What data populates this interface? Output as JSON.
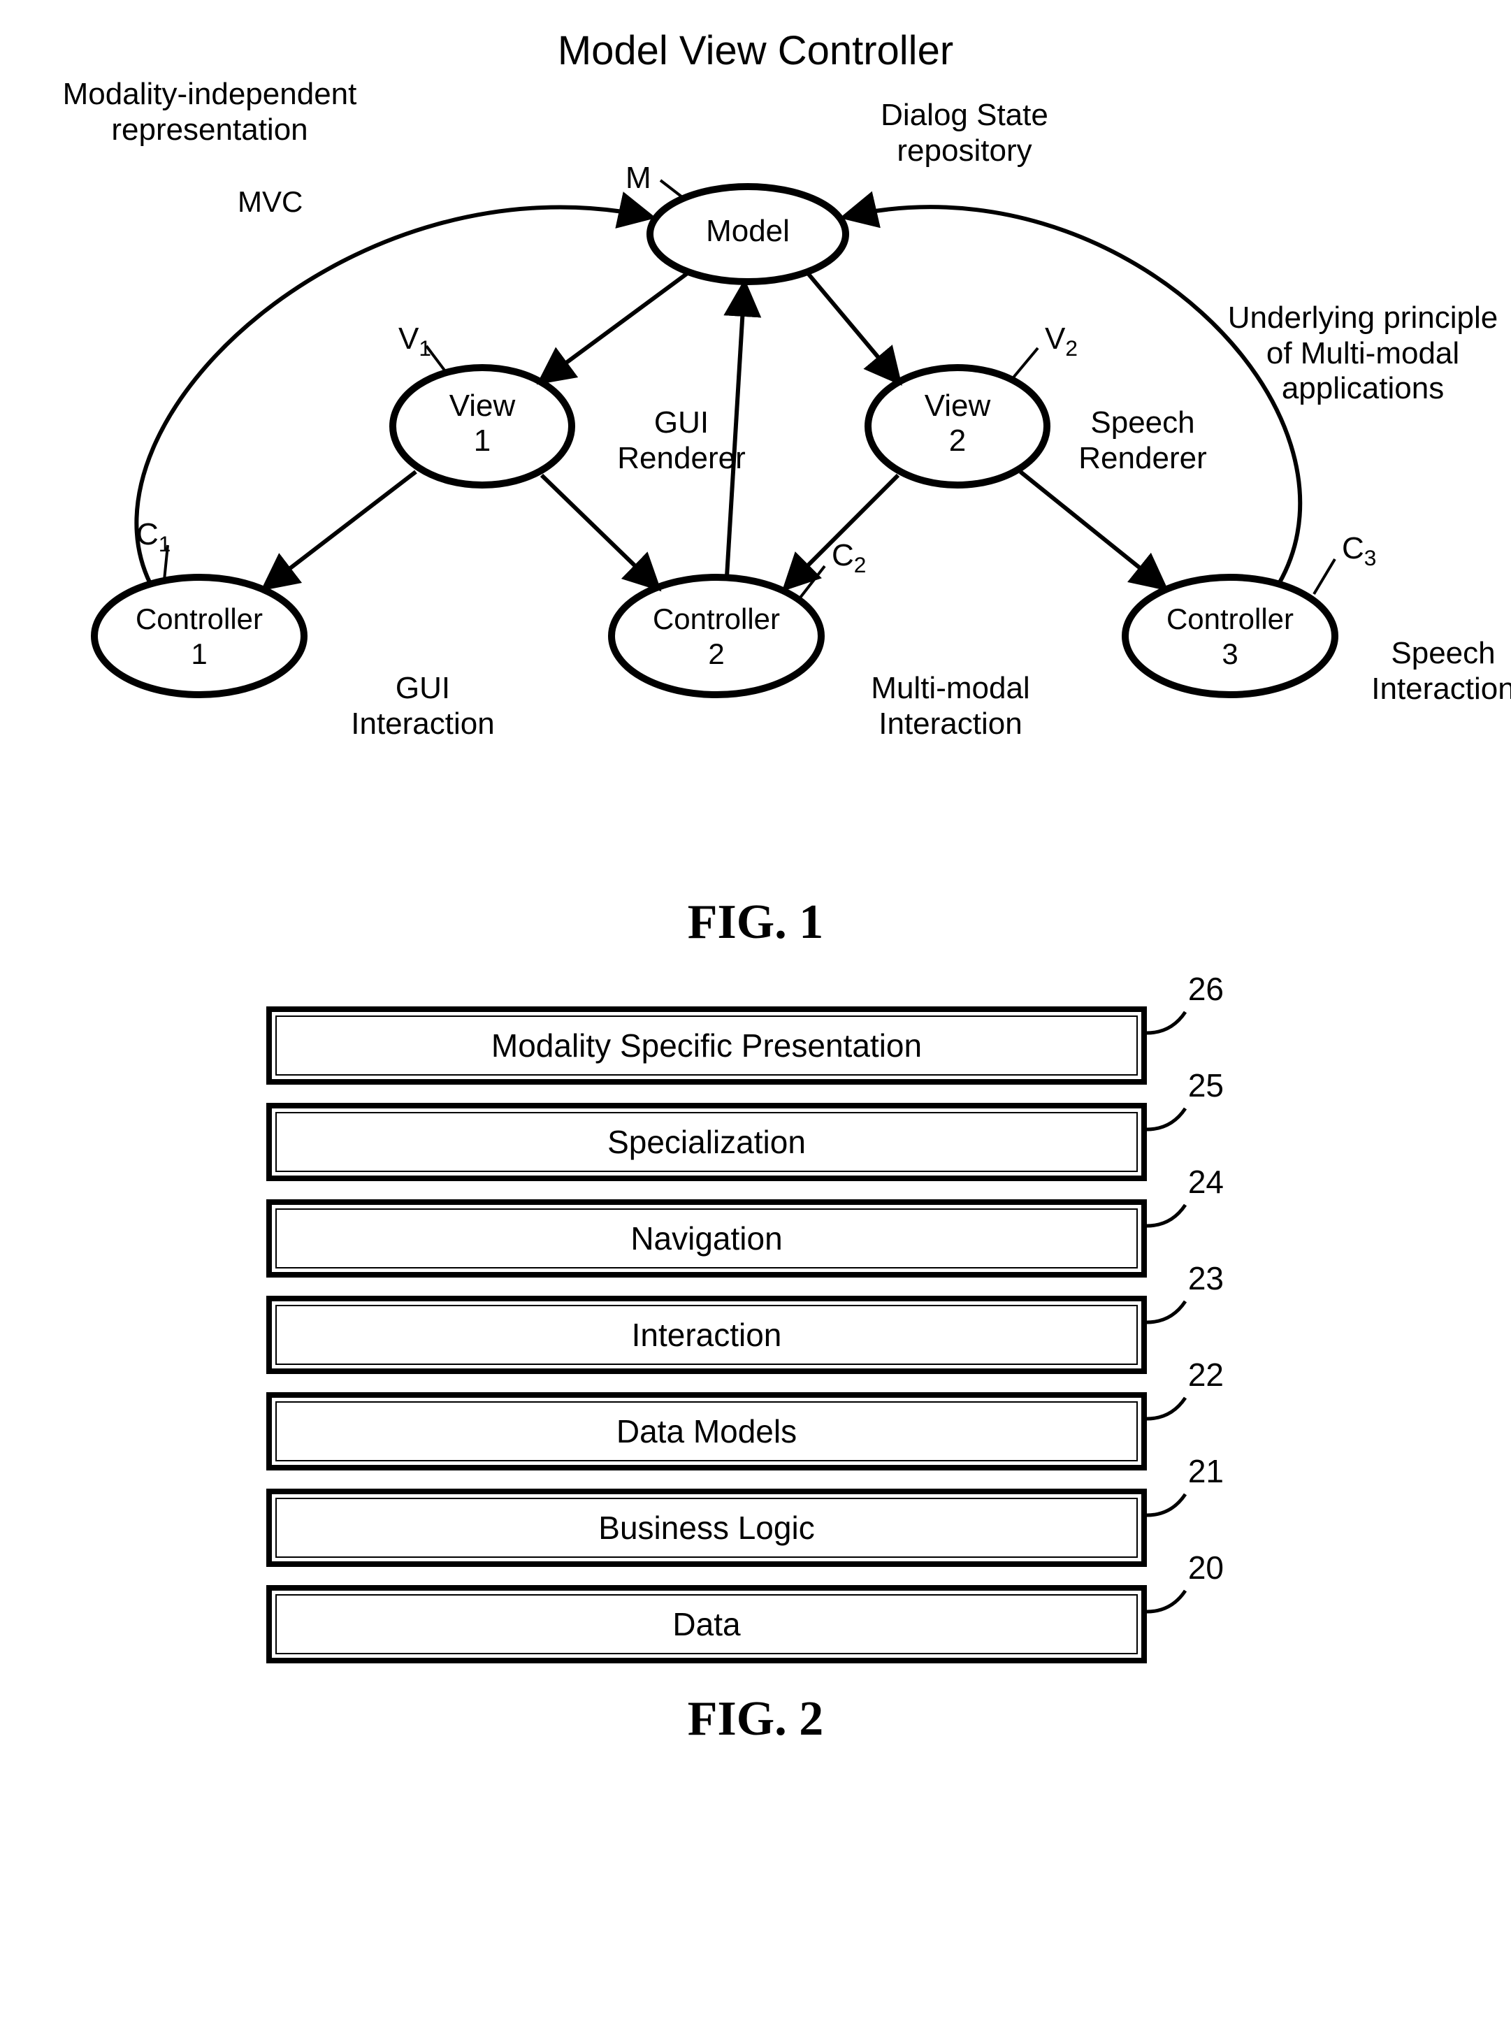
{
  "fig1": {
    "title": "Model View Controller",
    "annotations": {
      "modality_independent": "Modality-independent\nrepresentation",
      "dialog_state": "Dialog State\nrepository",
      "mvc": "MVC",
      "underlying": "Underlying principle\nof Multi-modal\napplications",
      "gui_renderer": "GUI\nRenderer",
      "speech_renderer": "Speech\nRenderer",
      "gui_interaction": "GUI\nInteraction",
      "multimodal_interaction": "Multi-modal\nInteraction",
      "speech_interaction": "Speech\nInteraction"
    },
    "refs": {
      "M": "M",
      "V1": "V",
      "V1sub": "1",
      "V2": "V",
      "V2sub": "2",
      "C1": "C",
      "C1sub": "1",
      "C2": "C",
      "C2sub": "2",
      "C3": "C",
      "C3sub": "3"
    },
    "nodes": {
      "model": "Model",
      "view1": "View\n1",
      "view2": "View\n2",
      "controller1": "Controller\n1",
      "controller2": "Controller\n2",
      "controller3": "Controller\n3"
    },
    "caption": "FIG. 1"
  },
  "fig2": {
    "layers": [
      {
        "num": "26",
        "label": "Modality Specific Presentation"
      },
      {
        "num": "25",
        "label": "Specialization"
      },
      {
        "num": "24",
        "label": "Navigation"
      },
      {
        "num": "23",
        "label": "Interaction"
      },
      {
        "num": "22",
        "label": "Data Models"
      },
      {
        "num": "21",
        "label": "Business Logic"
      },
      {
        "num": "20",
        "label": "Data"
      }
    ],
    "caption": "FIG. 2"
  }
}
